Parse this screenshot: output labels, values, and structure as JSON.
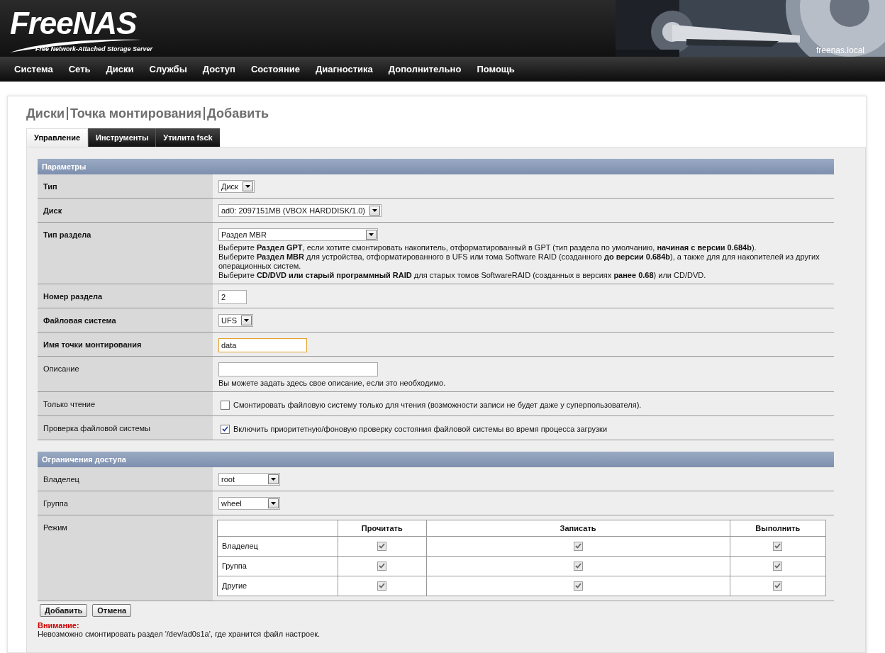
{
  "header": {
    "logo_title": "FreeNAS",
    "logo_subtitle": "Free Network-Attached Storage Server",
    "hostname": "freenas.local"
  },
  "nav": [
    "Система",
    "Сеть",
    "Диски",
    "Службы",
    "Доступ",
    "Состояние",
    "Диагностика",
    "Дополнительно",
    "Помощь"
  ],
  "page_title": [
    "Диски",
    "Точка монтирования",
    "Добавить"
  ],
  "tabs": [
    {
      "label": "Управление",
      "selected": true
    },
    {
      "label": "Инструменты",
      "selected": false
    },
    {
      "label": "Утилита fsck",
      "selected": false
    }
  ],
  "sections": [
    {
      "title": "Параметры",
      "rows": [
        {
          "kind": "select",
          "label": "Тип",
          "required": true,
          "value": "Диск"
        },
        {
          "kind": "select",
          "label": "Диск",
          "required": true,
          "value": "ad0: 2097151MB (VBOX HARDDISK/1.0)"
        },
        {
          "kind": "select",
          "label": "Тип раздела",
          "required": true,
          "value": "Раздел MBR",
          "help": [
            "Выберите **Раздел GPT**, если хотите смонтировать накопитель, отформатированный в GPT (тип раздела по умолчанию, **начиная с версии 0.684b**).",
            "Выберите **Раздел MBR** для устройства, отформатированного в UFS или тома Software RAID (созданного **до версии 0.684b**), а также для для накопителей из других операционных систем.",
            "Выберите **CD/DVD или старый программный RAID** для старых томов SoftwareRAID (созданных в версиях **ранее 0.68**) или CD/DVD."
          ]
        },
        {
          "kind": "input",
          "label": "Номер раздела",
          "required": true,
          "value": "2",
          "focused": false
        },
        {
          "kind": "select",
          "label": "Файловая система",
          "required": true,
          "value": "UFS"
        },
        {
          "kind": "input",
          "label": "Имя точки монтирования",
          "required": true,
          "value": "data",
          "focused": true
        },
        {
          "kind": "input",
          "label": "Описание",
          "required": false,
          "value": "",
          "focused": false,
          "help": [
            "Вы можете задать здесь свое описание, если это необходимо."
          ]
        },
        {
          "kind": "checkbox",
          "label": "Только чтение",
          "required": false,
          "checked": false,
          "text": "Смонтировать файловую систему только для чтения (возможности записи не будет даже у суперпользователя)."
        },
        {
          "kind": "checkbox",
          "label": "Проверка файловой системы",
          "required": false,
          "checked": true,
          "text": "Включить приоритетную/фоновую проверку состояния файловой системы во время процесса загрузки"
        }
      ]
    },
    {
      "title": "Ограничения доступа",
      "rows": [
        {
          "kind": "select",
          "label": "Владелец",
          "required": false,
          "value": "root"
        },
        {
          "kind": "select",
          "label": "Группа",
          "required": false,
          "value": "wheel"
        },
        {
          "kind": "permissions",
          "label": "Режим",
          "required": false,
          "columns": [
            "Прочитать",
            "Записать",
            "Выполнить"
          ],
          "rows": [
            {
              "label": "Владелец",
              "checks": [
                true,
                true,
                true
              ]
            },
            {
              "label": "Группа",
              "checks": [
                true,
                true,
                true
              ]
            },
            {
              "label": "Другие",
              "checks": [
                true,
                true,
                true
              ]
            }
          ]
        }
      ]
    }
  ],
  "buttons": [
    "Добавить",
    "Отмена"
  ],
  "warning": {
    "title": "Внимание:",
    "text": "Невозможно смонтировать раздел '/dev/ad0s1a', где хранится файл настроек."
  }
}
